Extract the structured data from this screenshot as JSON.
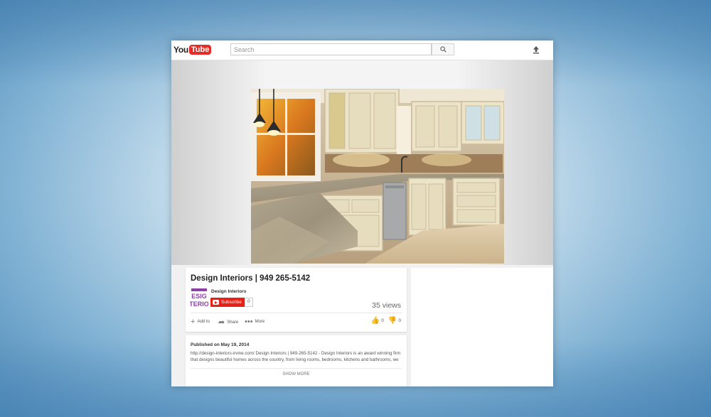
{
  "header": {
    "logo_you": "You",
    "logo_tube": "Tube",
    "search_placeholder": "Search",
    "icons": [
      "search-icon",
      "upload-icon"
    ]
  },
  "video": {
    "title": "Design Interiors | 949 265-5142",
    "channel": "Design Interiors",
    "avatar_text": [
      "ESIG",
      "TERIO"
    ],
    "subscribe_label": "Subscribe",
    "subscriber_count": "0",
    "views": "35 views",
    "actions": {
      "add_to": "Add to",
      "share": "Share",
      "more": "More"
    },
    "likes": "0",
    "dislikes": "0"
  },
  "description": {
    "published": "Published on May 19, 2014",
    "text": "http://design-interiors-irvine.com/ Design Interiors | 949-265-5142 - Design Interiors is an award winning firm that designs beautiful homes across the country, from living rooms, bedrooms, kitchens and bathrooms, we",
    "show_more": "SHOW MORE"
  },
  "colors": {
    "brand_red": "#e52d27",
    "subscribe_red": "#e62117",
    "avatar_purple": "#8e3fa8"
  }
}
